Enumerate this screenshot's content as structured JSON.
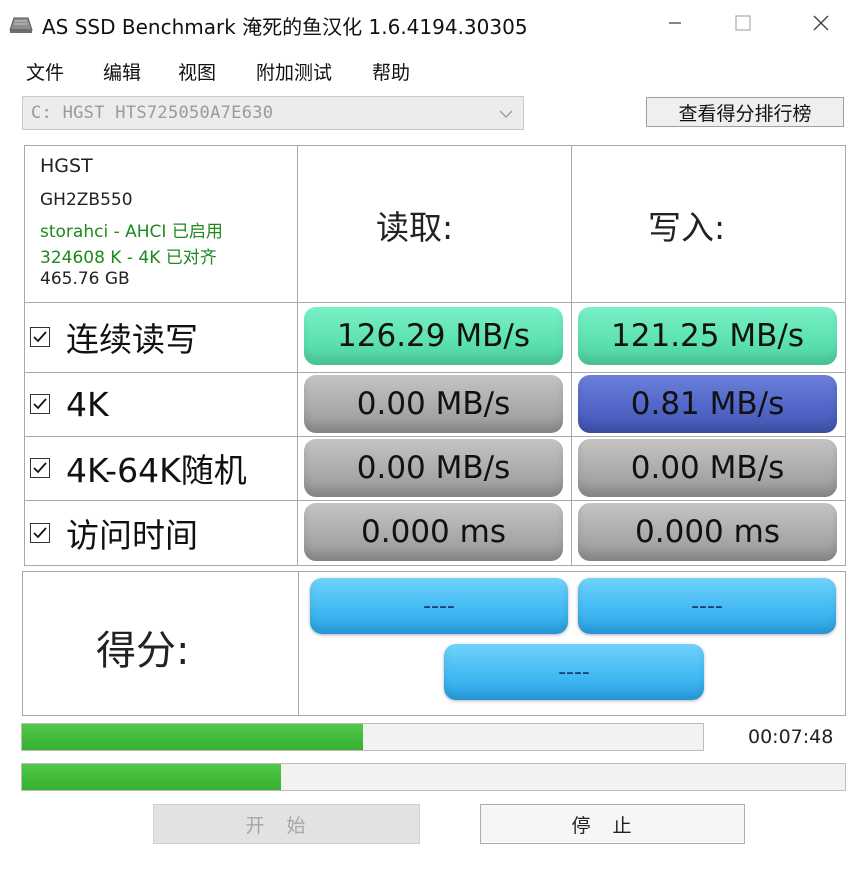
{
  "window": {
    "title": "AS SSD Benchmark 淹死的鱼汉化 1.6.4194.30305",
    "icon": "drive-icon",
    "controls": [
      "minimize-icon",
      "maximize-icon",
      "close-icon"
    ]
  },
  "menu": {
    "items": [
      "文件",
      "编辑",
      "视图",
      "附加测试",
      "帮助"
    ]
  },
  "drive": {
    "selected": "C: HGST HTS725050A7E630",
    "chevron_icon": "chevron-down-icon"
  },
  "leaderboard_button": "查看得分排行榜",
  "drive_info": {
    "vendor": "HGST",
    "firmware": "GH2ZB550",
    "driver": "storahci - AHCI 已启用",
    "alignment": "324608 K - 4K 已对齐",
    "capacity": "465.76 GB",
    "status_color": "#1c8a1c"
  },
  "columns": {
    "read": "读取:",
    "write": "写入:"
  },
  "tests": [
    {
      "label": "连续读写",
      "checked": true,
      "read": "126.29 MB/s",
      "write": "121.25 MB/s",
      "read_color": "#5ee3b2",
      "write_color": "#5ee3b2"
    },
    {
      "label": "4K",
      "checked": true,
      "read": "0.00 MB/s",
      "write": "0.81 MB/s",
      "read_color": "#a9a9a9",
      "write_color": "#5266c9"
    },
    {
      "label": "4K-64K随机",
      "checked": true,
      "read": "0.00 MB/s",
      "write": "0.00 MB/s",
      "read_color": "#a9a9a9",
      "write_color": "#a9a9a9"
    },
    {
      "label": "访问时间",
      "checked": true,
      "read": "0.000 ms",
      "write": "0.000 ms",
      "read_color": "#a9a9a9",
      "write_color": "#a9a9a9"
    }
  ],
  "score": {
    "label": "得分:",
    "read": "----",
    "write": "----",
    "total": "----",
    "color": "#44baf3"
  },
  "progress": {
    "current_fraction": 0.5,
    "overall_fraction": 0.315,
    "elapsed": "00:07:48",
    "color": "#36b02e"
  },
  "buttons": {
    "start": "开始",
    "abort": "停止"
  }
}
